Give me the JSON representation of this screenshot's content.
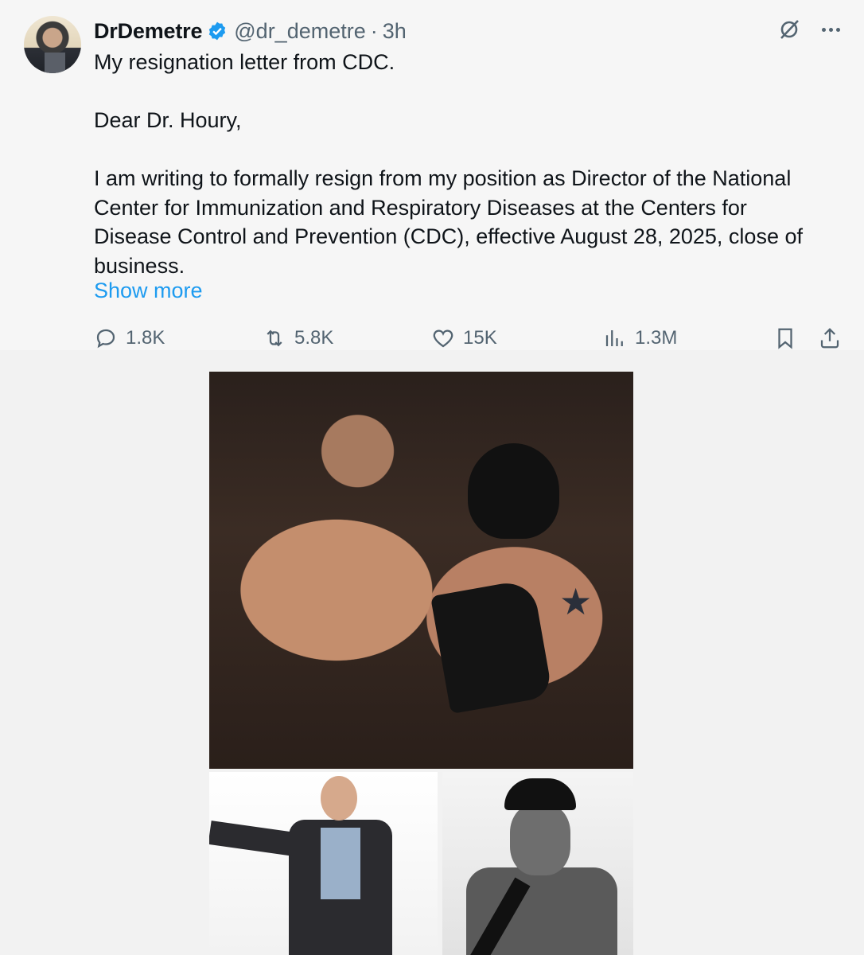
{
  "author": {
    "name": "DrDemetre",
    "handle": "@dr_demetre",
    "separator": "·",
    "time": "3h"
  },
  "tweet": {
    "text": "My resignation letter from CDC.\n\nDear Dr. Houry,\n\nI am writing to formally resign from my position as Director of the National\nCenter for Immunization and Respiratory Diseases at the Centers for\nDisease Control and Prevention (CDC), effective August 28, 2025, close of\nbusiness.",
    "show_more": "Show more"
  },
  "actions": {
    "replies": "1.8K",
    "reposts": "5.8K",
    "likes": "15K",
    "views": "1.3M"
  },
  "icons": {
    "verified": "verified-badge-icon",
    "grok": "grok-icon",
    "more": "more-icon",
    "reply": "reply-icon",
    "repost": "repost-icon",
    "like": "heart-icon",
    "views": "views-chart-icon",
    "bookmark": "bookmark-icon",
    "share": "share-icon"
  },
  "colors": {
    "link": "#1d9bf0",
    "secondary_text": "#536471",
    "verified": "#1d9bf0"
  }
}
